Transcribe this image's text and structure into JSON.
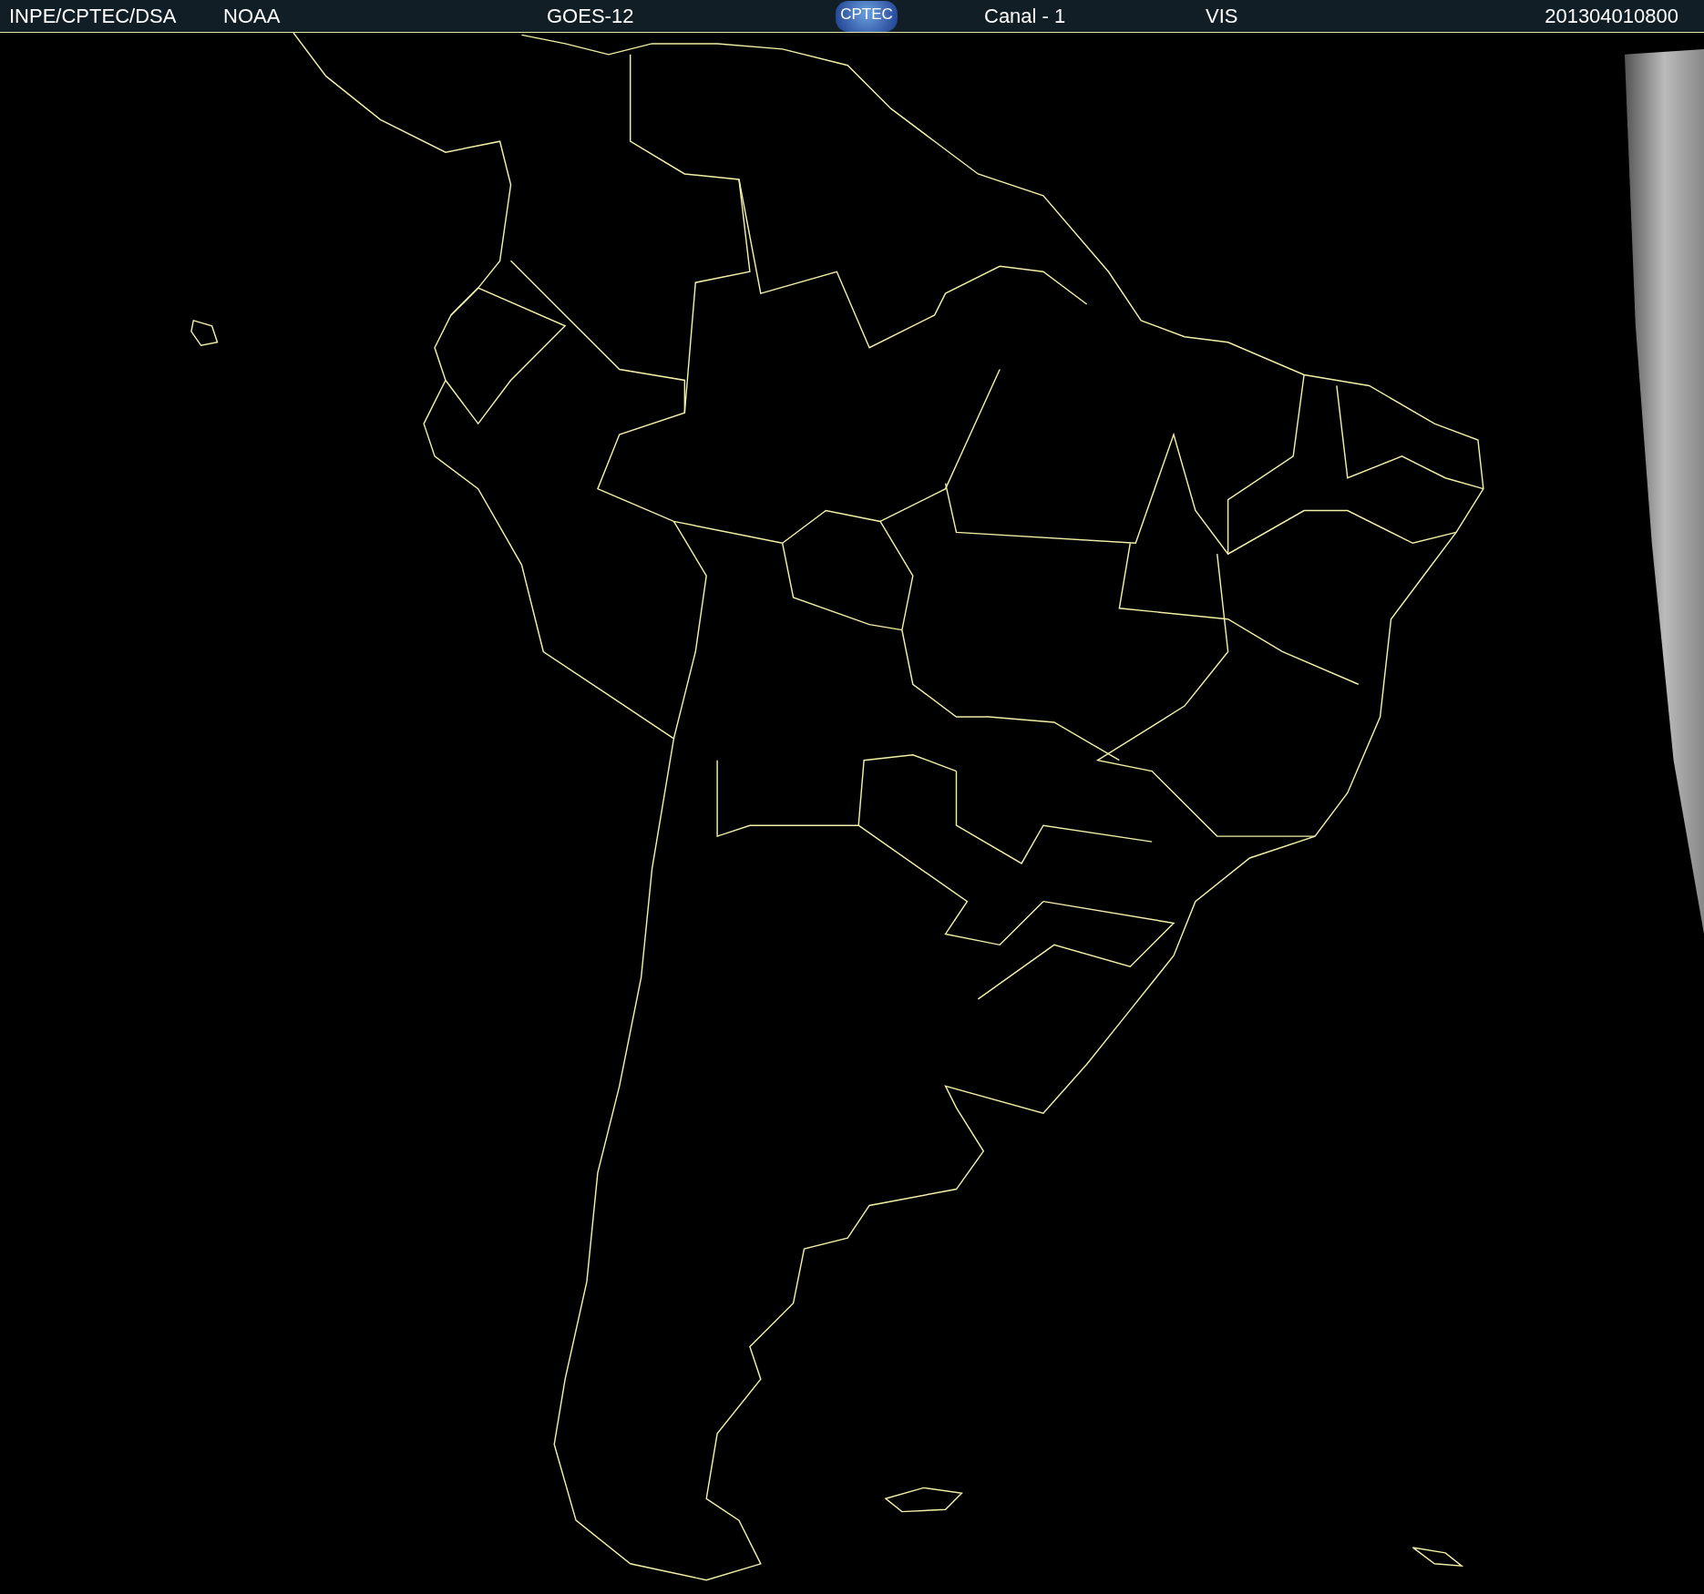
{
  "header": {
    "source": "INPE/CPTEC/DSA",
    "agency": "NOAA",
    "satellite": "GOES-12",
    "logo_text": "CPTEC",
    "channel": "Canal - 1",
    "band": "VIS",
    "timestamp": "201304010800"
  }
}
